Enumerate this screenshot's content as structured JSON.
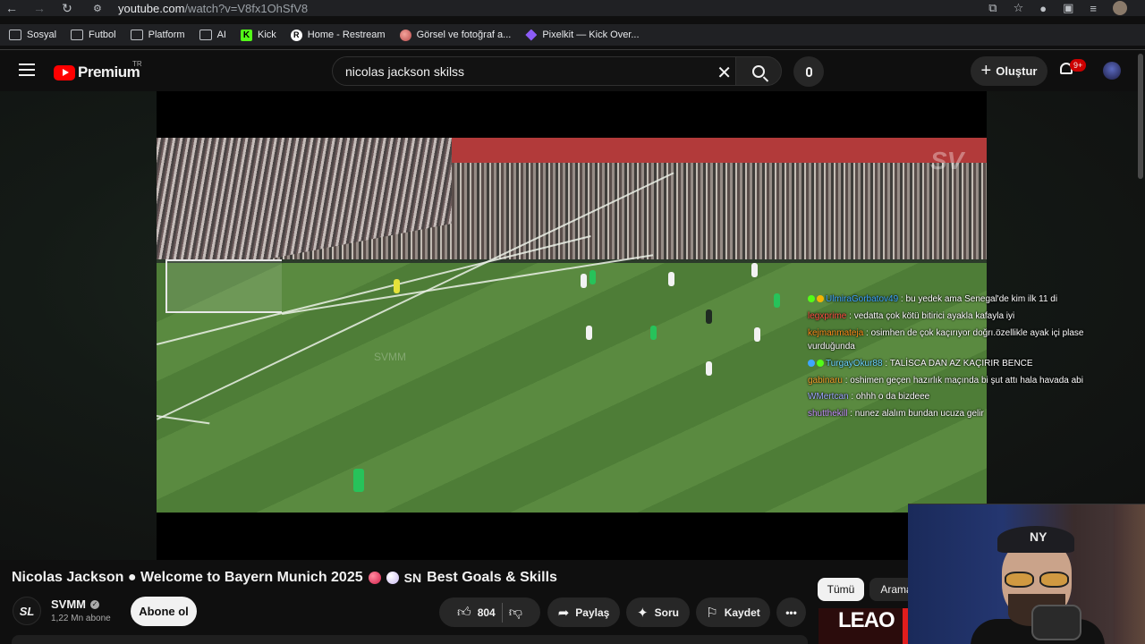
{
  "browser": {
    "url_host": "youtube.com",
    "url_path": "/watch?v=V8fx1OhSfV8",
    "bookmarks": [
      {
        "label": "Sosyal",
        "icon": "folder-icon"
      },
      {
        "label": "Futbol",
        "icon": "folder-icon"
      },
      {
        "label": "Platform",
        "icon": "folder-icon"
      },
      {
        "label": "AI",
        "icon": "folder-icon"
      },
      {
        "label": "Kick",
        "icon": "kick-icon"
      },
      {
        "label": "Home - Restream",
        "icon": "restream-icon"
      },
      {
        "label": "Görsel ve fotoğraf a...",
        "icon": "image-site-icon"
      },
      {
        "label": "Pixelkit — Kick Over...",
        "icon": "pixelkit-icon"
      }
    ]
  },
  "header": {
    "logo_text": "Premium",
    "region": "TR",
    "search_query": "nicolas jackson skilss",
    "create_label": "Oluştur",
    "notification_count": "9+"
  },
  "video": {
    "watermark": "SV",
    "watermark_small": "SVMM",
    "chat": [
      {
        "user": "UlmiraGorbatov49",
        "user_color": "#3ea6ff",
        "message": " : bu yedek ama Senegal'de kim ilk 11 di"
      },
      {
        "user": "legxprime",
        "user_color": "#ff4e45",
        "message": " : vedatta çok kötü bitirici ayakla kafayla iyi"
      },
      {
        "user": "kejmanmateja",
        "user_color": "#ff8c1a",
        "message": " : osimhen de çok kaçırıyor doğrı.özellikle ayak içi plase vurduğunda"
      },
      {
        "user": "TurgayOkur88",
        "user_color": "#6bd5ff",
        "message": " : TALİSCA DAN AZ KAÇIRIR BENCE"
      },
      {
        "user": "gabinaru",
        "user_color": "#f2a22a",
        "message": " : oshimen geçen hazırlık maçında bi şut attı hala havada abi"
      },
      {
        "user": "WMertcan",
        "user_color": "#9ea6ff",
        "message": " : ohhh o da bizdeee"
      },
      {
        "user": "shutthekill",
        "user_color": "#c792ff",
        "message": " : nunez alalım bundan ucuza gelir"
      }
    ]
  },
  "info": {
    "title_part1": "Nicolas Jackson ● Welcome to Bayern Munich 2025",
    "title_part2": "Best Goals & Skills",
    "title_sn": "SN",
    "channel_initials": "SL",
    "channel_name": "SVMM",
    "subscribers": "1,22 Mn abone",
    "subscribe_label": "Abone ol",
    "likes": "804",
    "share_label": "Paylaş",
    "ask_label": "Soru",
    "save_label": "Kaydet",
    "more_label": "•••"
  },
  "sidebar": {
    "chip_all": "Tümü",
    "chip_search": "Arama",
    "thumb_text": "LEAO"
  },
  "webcam": {
    "cap_logo": "NY"
  },
  "colors": {
    "accent_red": "#ff0000",
    "background": "#0f0f0f",
    "pill_bg": "#272727"
  }
}
